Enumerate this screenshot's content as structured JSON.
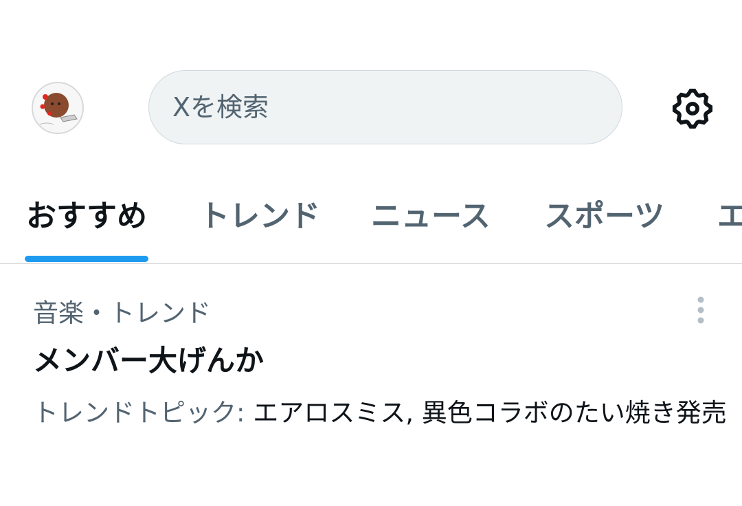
{
  "header": {
    "search_placeholder": "Xを検索",
    "avatar": "user-avatar",
    "settings_icon": "gear-icon"
  },
  "tabs": [
    {
      "label": "おすすめ",
      "active": true
    },
    {
      "label": "トレンド",
      "active": false
    },
    {
      "label": "ニュース",
      "active": false
    },
    {
      "label": "スポーツ",
      "active": false
    },
    {
      "label": "エ",
      "active": false
    }
  ],
  "trend": {
    "category": "音楽・トレンド",
    "title": "メンバー大げんか",
    "topic_label": "トレンドトピック:",
    "topic_value": " エアロスミス, 異色コラボのたい焼き発売",
    "more_icon": "more-vertical-icon"
  },
  "colors": {
    "accent": "#1d9bf0",
    "text_primary": "#0f1419",
    "text_secondary": "#536471",
    "search_bg": "#eff3f4"
  }
}
